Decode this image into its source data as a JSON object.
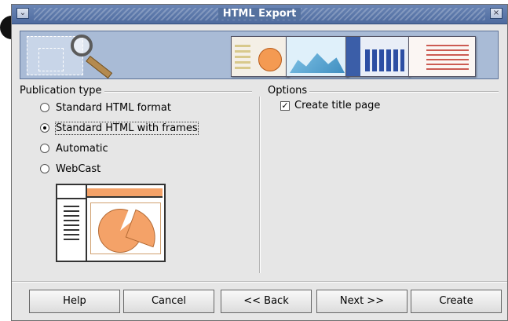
{
  "window": {
    "title": "HTML Export",
    "menu_icon": "chevron-down-icon",
    "close_icon": "close-icon"
  },
  "publication": {
    "label": "Publication type",
    "options": [
      {
        "label": "Standard HTML format",
        "selected": false
      },
      {
        "label": "Standard HTML with frames",
        "selected": true
      },
      {
        "label": "Automatic",
        "selected": false
      },
      {
        "label": "WebCast",
        "selected": false
      }
    ]
  },
  "options": {
    "label": "Options",
    "create_title_page": {
      "label": "Create title page",
      "checked": true,
      "mark": "✓"
    }
  },
  "buttons": {
    "help": "Help",
    "cancel": "Cancel",
    "back": "<< Back",
    "next": "Next >>",
    "create": "Create"
  }
}
